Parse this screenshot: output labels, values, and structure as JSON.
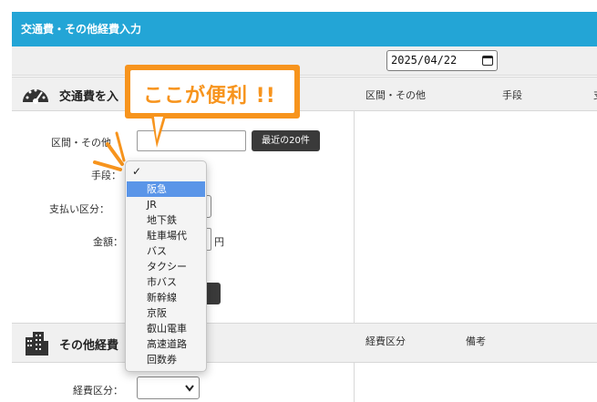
{
  "app": {
    "title": "交通費・その他経費入力"
  },
  "date": {
    "value": "2025/04/22"
  },
  "transport": {
    "title": "交通費を入",
    "fields": {
      "section_label": "区間・その他",
      "recent_button": "最近の20件",
      "means_label": "手段：",
      "payment_label": "支払い区分：",
      "amount_label": "金額：",
      "yen": "円"
    }
  },
  "callout": {
    "text": "ここが便利 !!"
  },
  "dropdown": {
    "checkmark": "✓",
    "options": [
      "阪急",
      "JR",
      "地下鉄",
      "駐車場代",
      "バス",
      "タクシー",
      "市バス",
      "新幹線",
      "京阪",
      "叡山電車",
      "高速道路",
      "回数券"
    ],
    "selected": "阪急"
  },
  "transport_list": {
    "headers": [
      "区間・その他",
      "手段",
      "支"
    ]
  },
  "other": {
    "title": "その他経費",
    "category_label": "経費区分："
  },
  "other_list": {
    "headers": [
      "経費区分",
      "備考"
    ]
  },
  "colors": {
    "header_blue": "#23a5d6",
    "accent_orange": "#f7941d",
    "selection_blue": "#5a95e8"
  }
}
